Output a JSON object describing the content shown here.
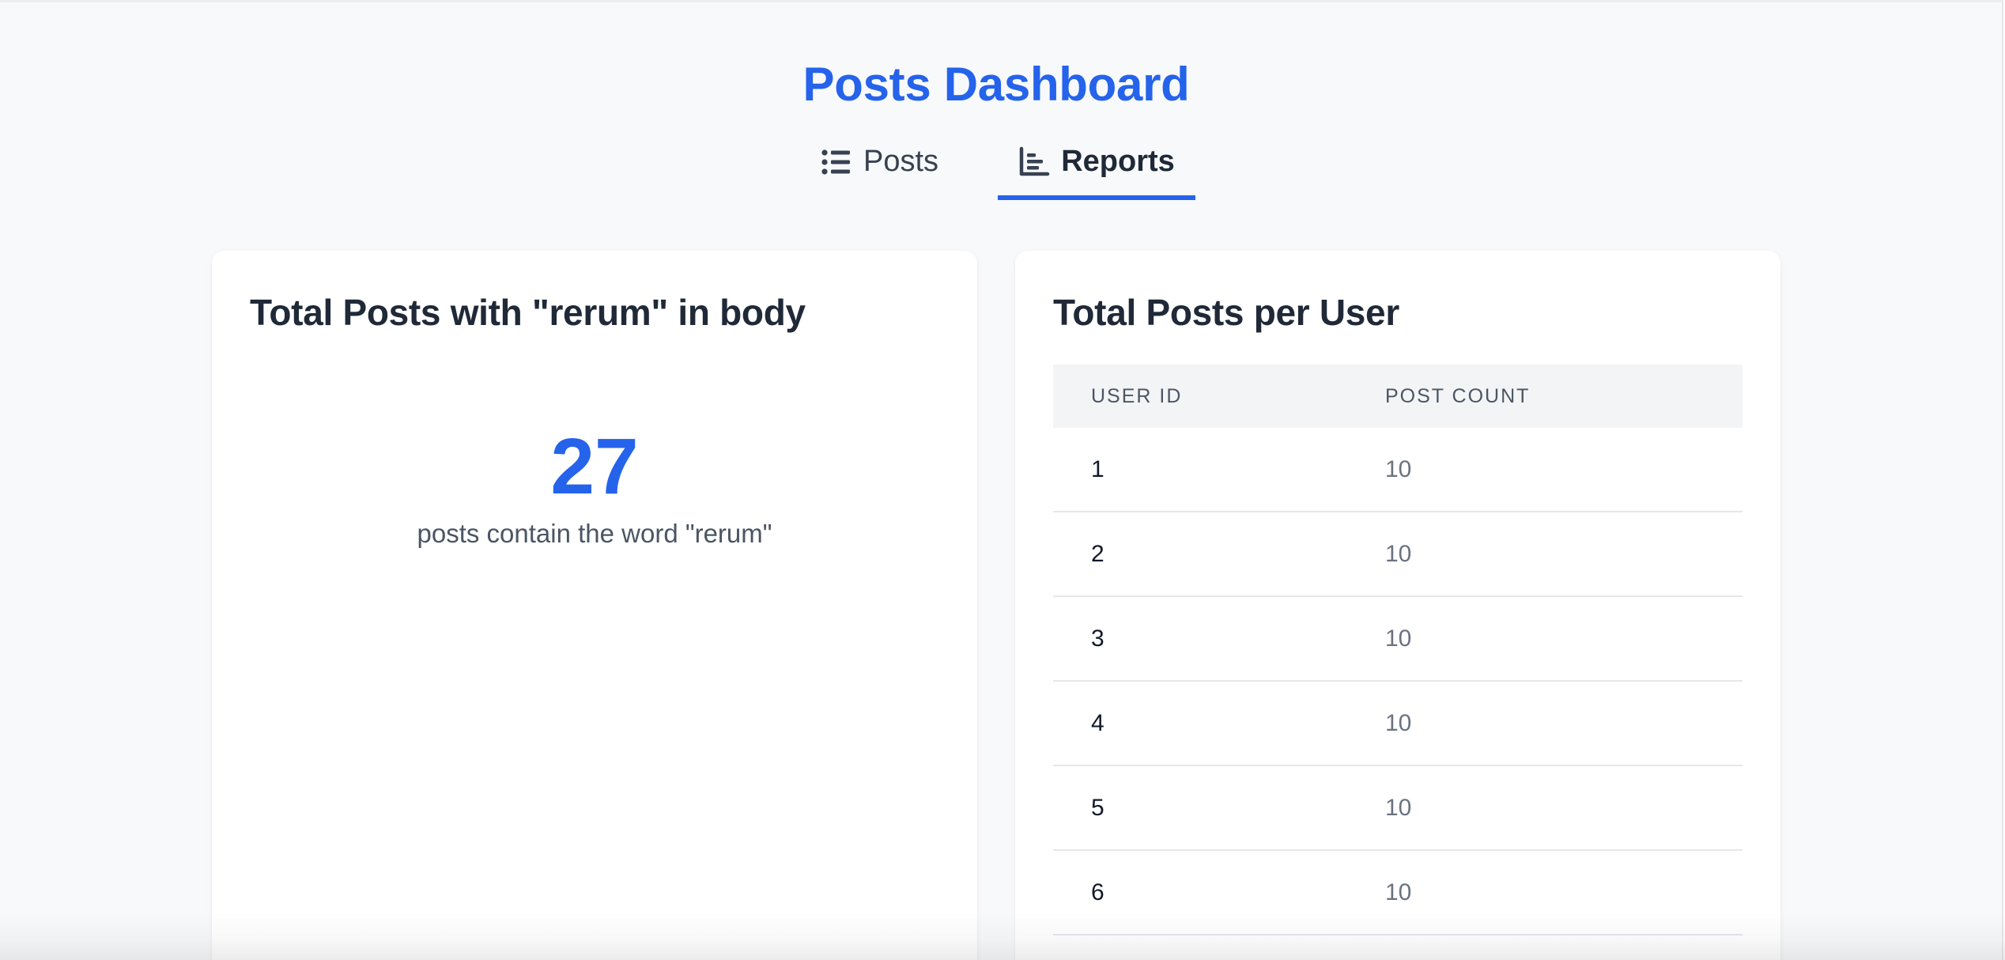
{
  "header": {
    "title": "Posts Dashboard"
  },
  "tabs": [
    {
      "label": "Posts",
      "icon": "list-icon",
      "active": false
    },
    {
      "label": "Reports",
      "icon": "bar-chart-icon",
      "active": true
    }
  ],
  "colors": {
    "accent": "#2563eb",
    "background": "#f8f9fb",
    "card": "#ffffff",
    "table_header": "#f3f4f6"
  },
  "cards": {
    "keyword": {
      "title": "Total Posts with \"rerum\" in body",
      "value": "27",
      "caption": "posts contain the word \"rerum\""
    },
    "per_user": {
      "title": "Total Posts per User",
      "columns": [
        "USER ID",
        "POST COUNT"
      ],
      "rows": [
        {
          "user_id": "1",
          "post_count": "10"
        },
        {
          "user_id": "2",
          "post_count": "10"
        },
        {
          "user_id": "3",
          "post_count": "10"
        },
        {
          "user_id": "4",
          "post_count": "10"
        },
        {
          "user_id": "5",
          "post_count": "10"
        },
        {
          "user_id": "6",
          "post_count": "10"
        }
      ]
    }
  }
}
